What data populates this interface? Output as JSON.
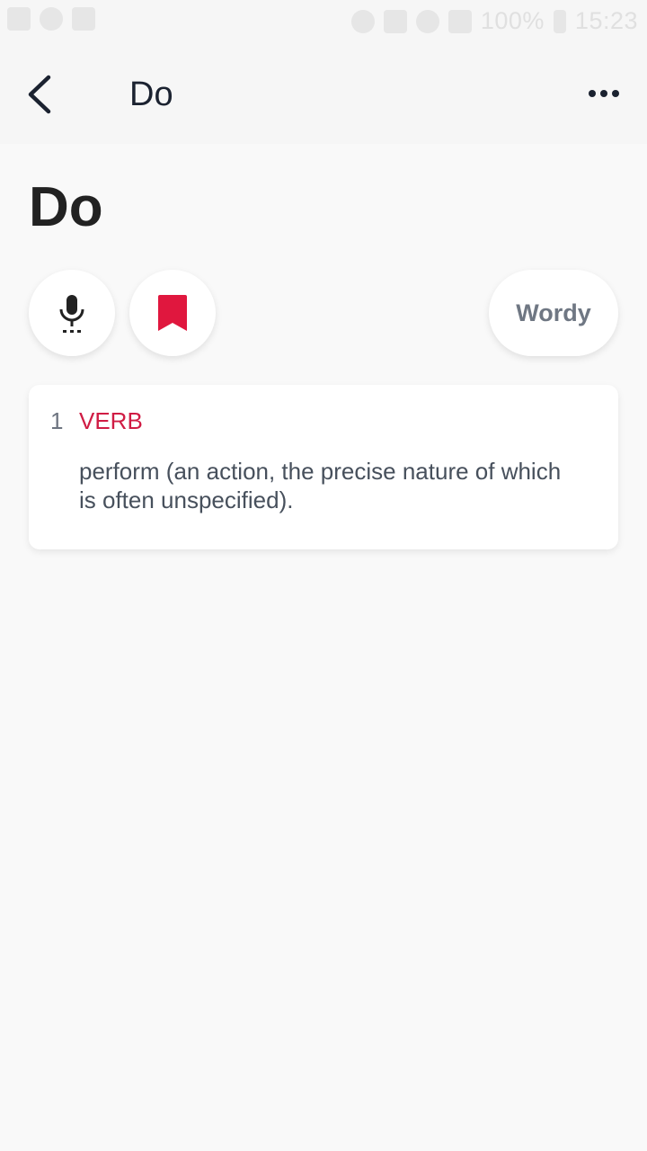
{
  "status_bar": {
    "battery": "100%",
    "time": "15:23"
  },
  "app_bar": {
    "title": "Do",
    "back_icon": "chevron-left-icon",
    "more_icon": "more-horizontal-icon"
  },
  "word": {
    "headword": "Do"
  },
  "actions": {
    "pronounce_icon": "microphone-icon",
    "bookmark_icon": "bookmark-icon",
    "bookmark_color": "#e0173e",
    "source_label": "Wordy"
  },
  "definitions": [
    {
      "number": "1",
      "part_of_speech": "VERB",
      "text": "perform (an action, the precise nature of which is often unspecified)."
    }
  ],
  "colors": {
    "accent": "#d01c44",
    "background": "#f9f9f9",
    "text_primary": "#222222",
    "text_secondary": "#47505c"
  }
}
